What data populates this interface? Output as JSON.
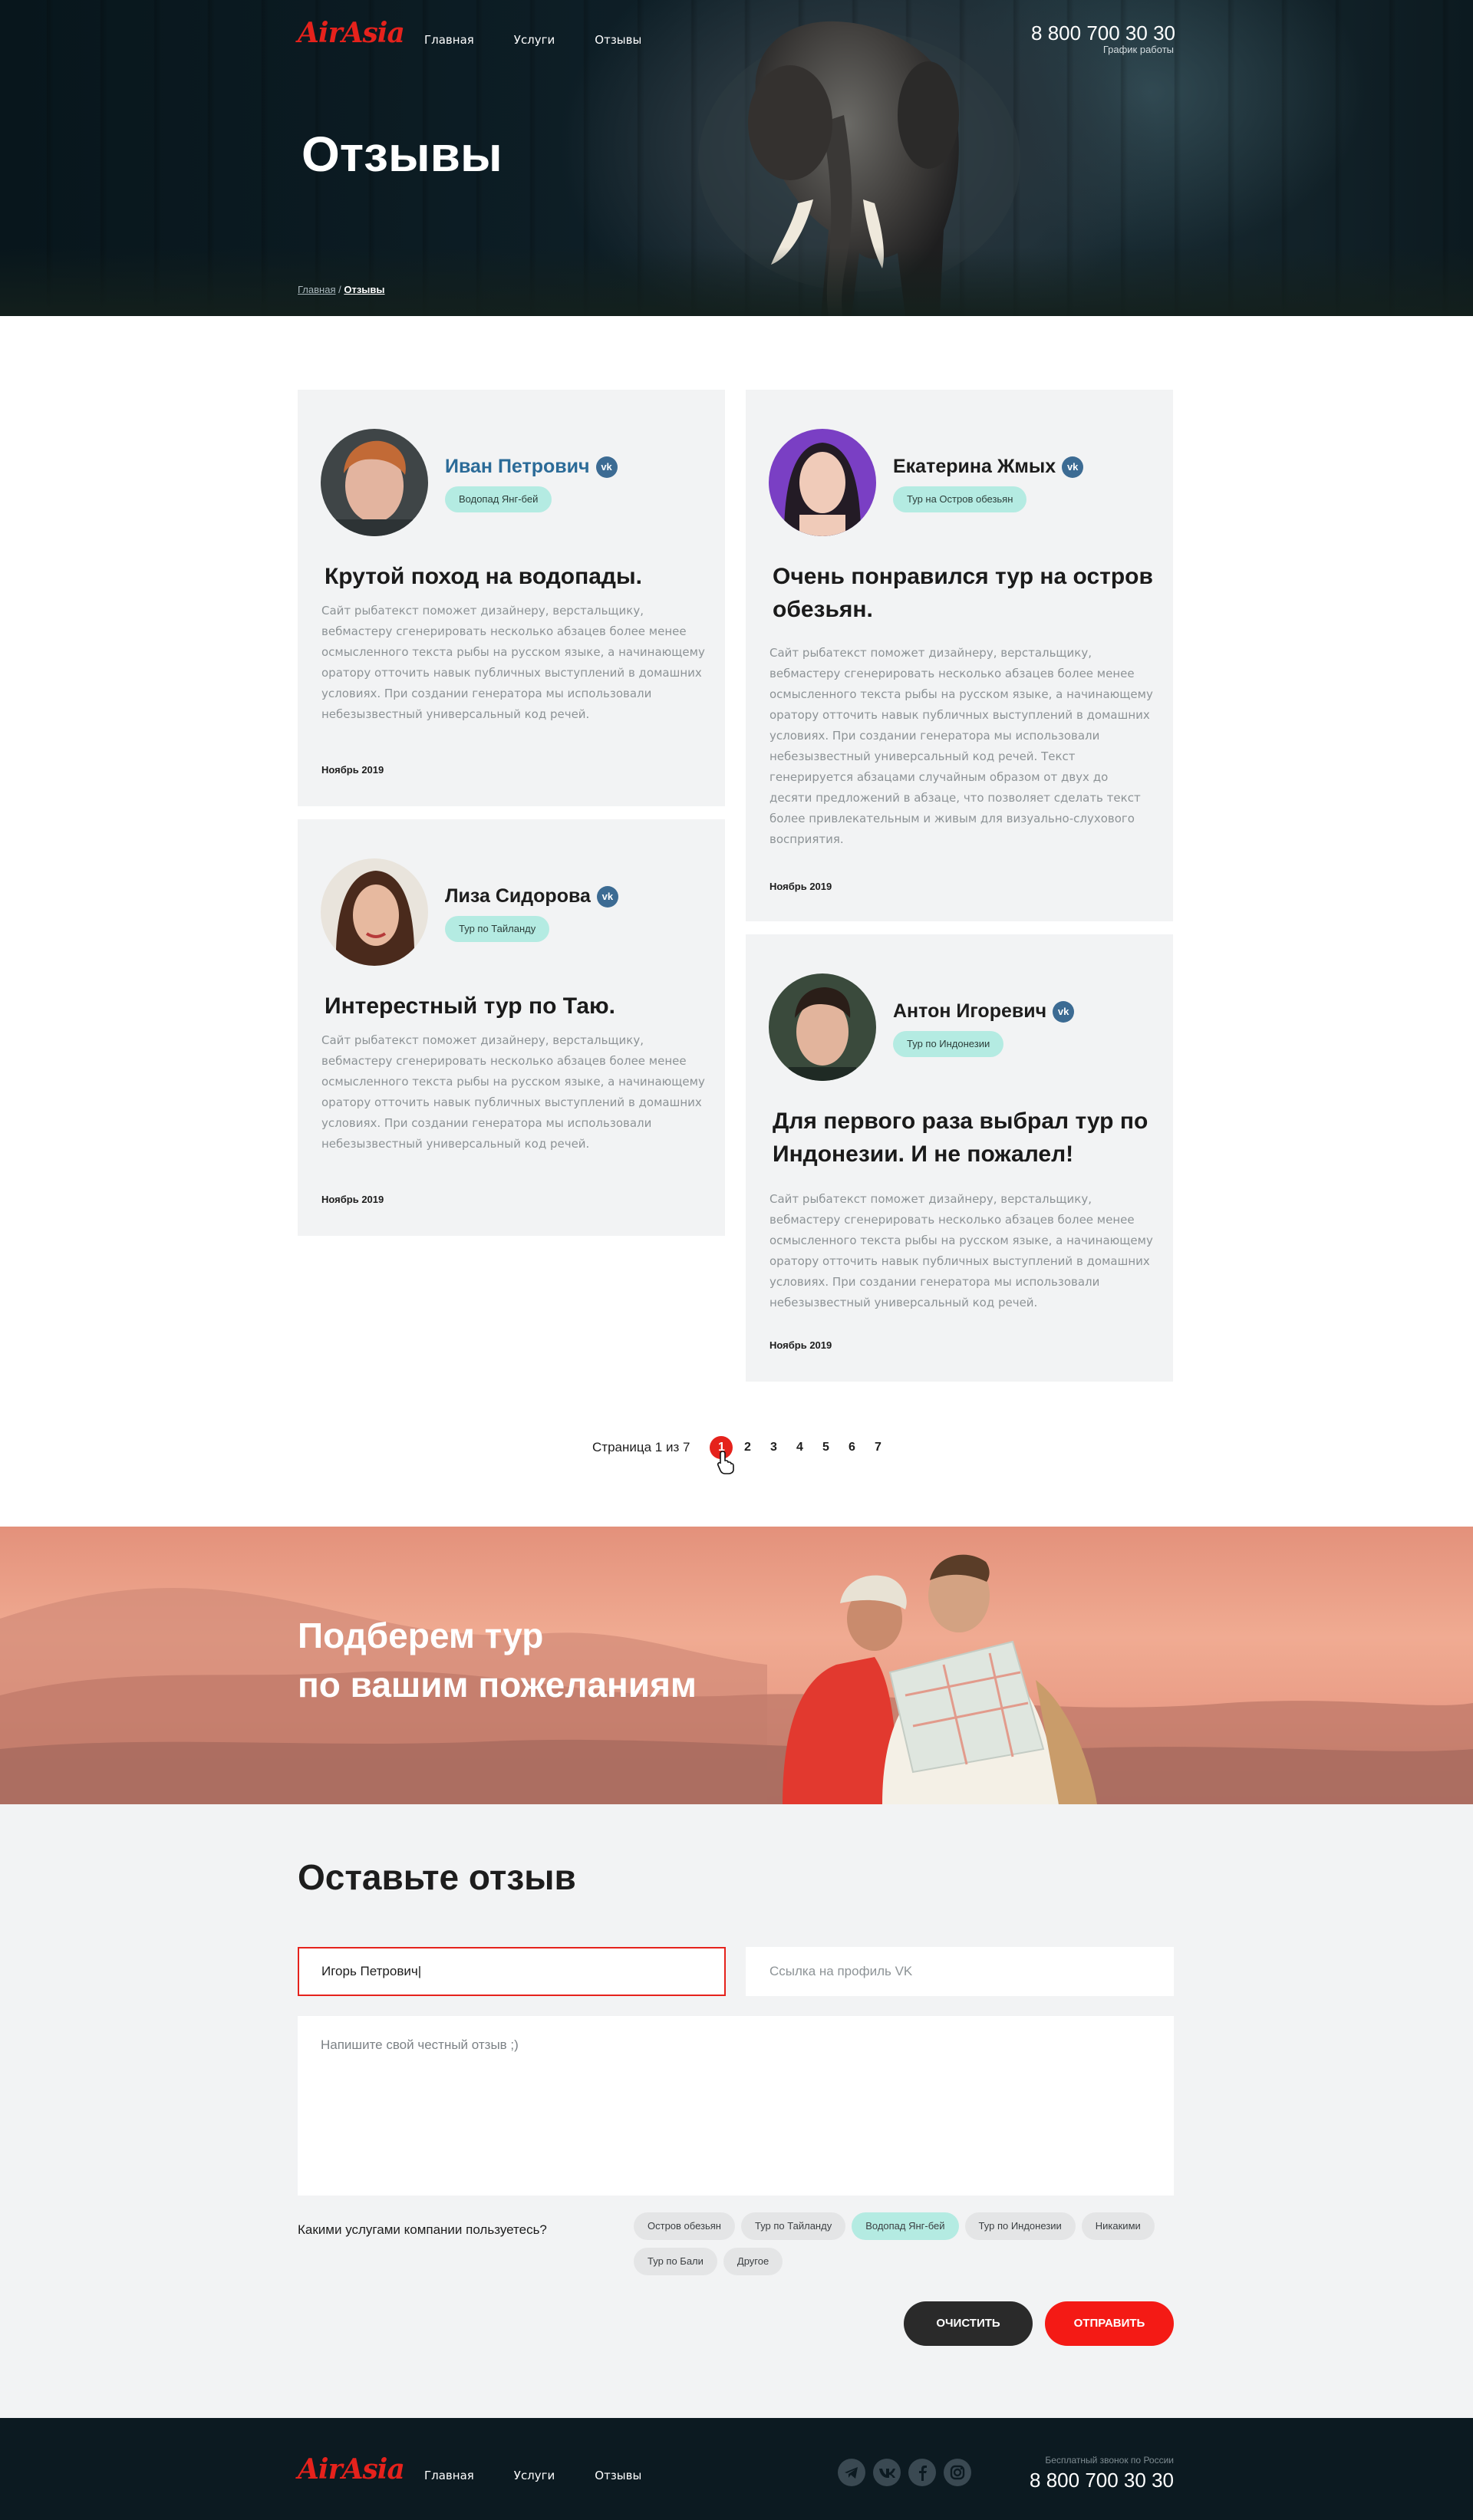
{
  "header": {
    "logo": "AirAsia",
    "nav": [
      "Главная",
      "Услуги",
      "Отзывы"
    ],
    "phone": "8 800 700 30 30",
    "phone_sub": "График работы"
  },
  "hero": {
    "title": "Отзывы",
    "breadcrumb": {
      "home": "Главная",
      "sep": "/",
      "current": "Отзывы"
    }
  },
  "reviews": [
    {
      "name": "Иван Петрович",
      "vk": "vk",
      "tag": "Водопад Янг-бей",
      "title": "Крутой поход на водопады.",
      "body": "Сайт рыбатекст поможет дизайнеру, верстальщику, вебмастеру сгенерировать несколько абзацев более менее осмысленного текста рыбы на русском языке, а начинающему оратору отточить навык публичных выступлений в домашних условиях. При создании генератора мы использовали небезызвестный универсальный код речей.",
      "date": "Ноябрь 2019"
    },
    {
      "name": "Екатерина Жмых",
      "vk": "vk",
      "tag": "Тур на Остров обезьян",
      "title": "Очень понравился тур на остров обезьян.",
      "body": "Сайт рыбатекст поможет дизайнеру, верстальщику, вебмастеру сгенерировать несколько абзацев более менее осмысленного текста рыбы на русском языке, а начинающему оратору отточить навык публичных выступлений в домашних условиях. При создании генератора мы использовали небезызвестный универсальный код речей. Текст генерируется абзацами случайным образом от двух до десяти предложений в абзаце, что позволяет сделать текст более привлекательным и живым для визуально-слухового восприятия.",
      "date": "Ноябрь 2019"
    },
    {
      "name": "Лиза Сидорова",
      "vk": "vk",
      "tag": "Тур по Тайланду",
      "title": "Интерестный тур по Таю.",
      "body": "Сайт рыбатекст поможет дизайнеру, верстальщику, вебмастеру сгенерировать несколько абзацев более менее осмысленного текста рыбы на русском языке, а начинающему оратору отточить навык публичных выступлений в домашних условиях. При создании генератора мы использовали небезызвестный универсальный код речей.",
      "date": "Ноябрь 2019"
    },
    {
      "name": "Антон Игоревич",
      "vk": "vk",
      "tag": "Тур по Индонезии",
      "title": "Для первого раза выбрал тур по Индонезии. И не пожалел!",
      "body": "Сайт рыбатекст поможет дизайнеру, верстальщику, вебмастеру сгенерировать несколько абзацев более менее осмысленного текста рыбы на русском языке, а начинающему оратору отточить навык публичных выступлений в домашних условиях. При создании генератора мы использовали небезызвестный универсальный код речей.",
      "date": "Ноябрь 2019"
    }
  ],
  "pagination": {
    "label": "Страница 1 из 7",
    "pages": [
      "1",
      "2",
      "3",
      "4",
      "5",
      "6",
      "7"
    ],
    "current": "1"
  },
  "promo": {
    "line1": "Подберем тур",
    "line2": "по вашим пожеланиям"
  },
  "form": {
    "title": "Оставьте отзыв",
    "name_value": "Игорь Петрович|",
    "vk_placeholder": "Ссылка на профиль VK",
    "review_placeholder": "Напишите свой честный отзыв ;)",
    "question": "Какими услугами компании пользуетесь?",
    "chips": [
      {
        "label": "Остров обезьян",
        "selected": false
      },
      {
        "label": "Тур по Тайланду",
        "selected": false
      },
      {
        "label": "Водопад Янг-бей",
        "selected": true
      },
      {
        "label": "Тур по Индонезии",
        "selected": false
      },
      {
        "label": "Никакими",
        "selected": false
      },
      {
        "label": "Тур по Бали",
        "selected": false
      },
      {
        "label": "Другое",
        "selected": false
      }
    ],
    "clear_label": "ОЧИСТИТЬ",
    "submit_label": "ОТПРАВИТЬ"
  },
  "footer": {
    "logo": "AirAsia",
    "nav": [
      "Главная",
      "Услуги",
      "Отзывы"
    ],
    "socials": [
      "telegram-icon",
      "vk-icon",
      "facebook-icon",
      "instagram-icon"
    ],
    "note": "Бесплатный звонок по России",
    "phone": "8 800 700 30 30"
  },
  "colors": {
    "accent": "#e5221c",
    "tag": "#b4ebe2",
    "card_bg": "#f2f3f4",
    "dark": "#0c1a21"
  }
}
